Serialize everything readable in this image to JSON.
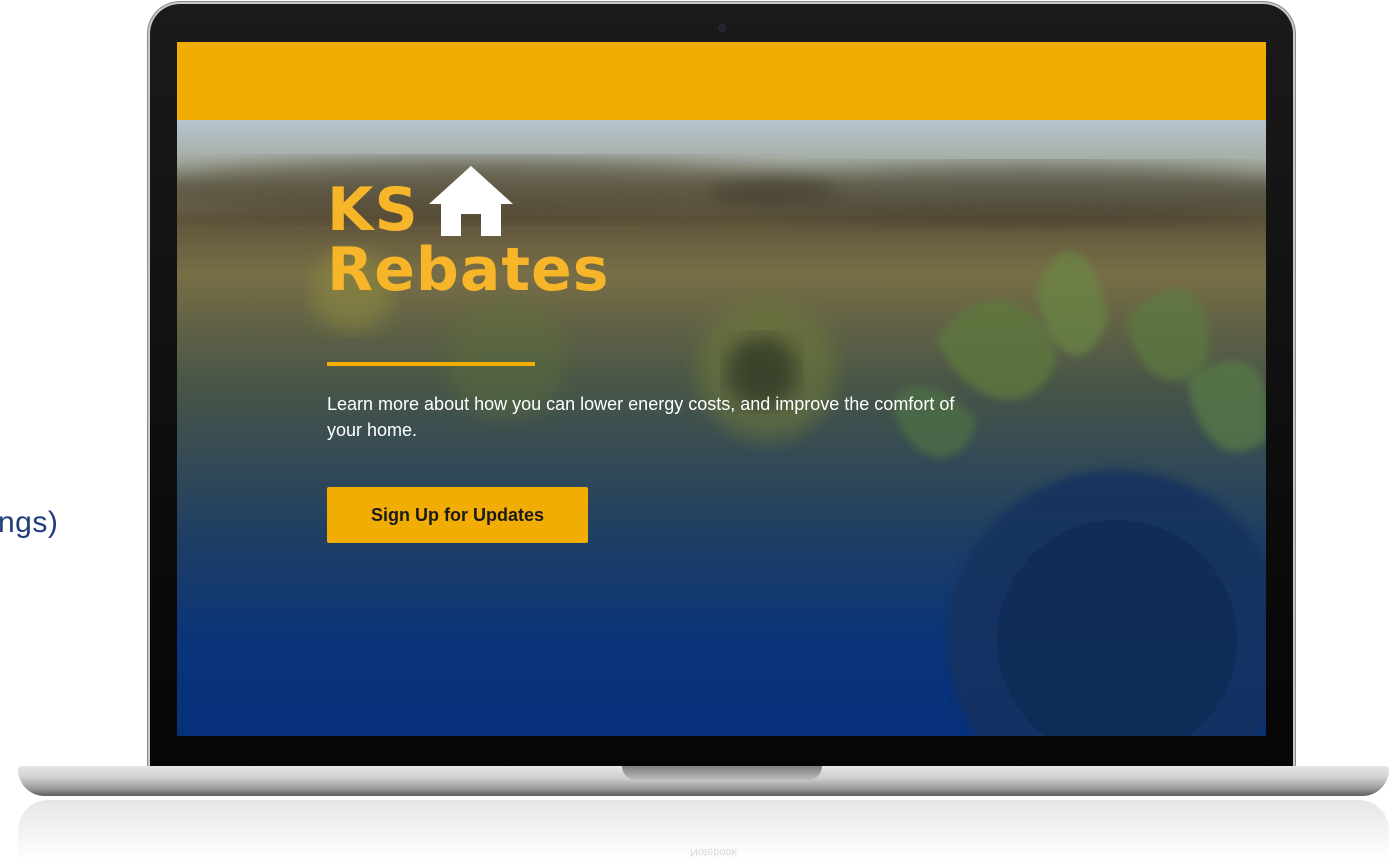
{
  "side_text": "ngs)",
  "hero": {
    "brand_line1": "KS",
    "brand_line2": "Rebates",
    "tagline": "Learn more about how you can lower energy costs, and improve the comfort of your home.",
    "cta_label": "Sign Up for Updates"
  },
  "device": {
    "base_reflection_text": "Notebook"
  },
  "colors": {
    "accent": "#f2ad05",
    "logo_text": "#f7b52a",
    "hero_bottom": "#06307a"
  },
  "icons": [
    "house-icon"
  ]
}
